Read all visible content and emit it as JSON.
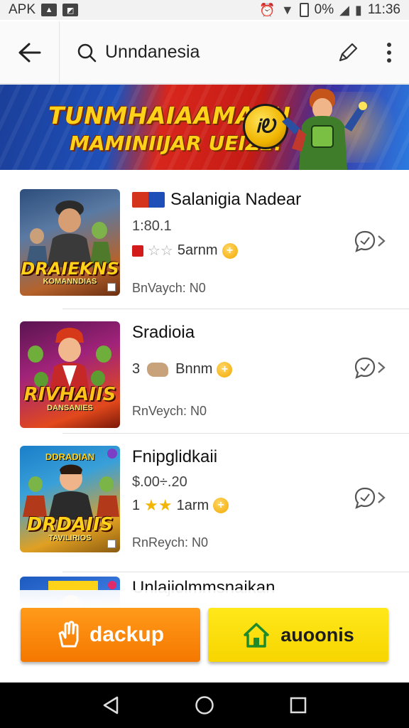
{
  "status_bar": {
    "left_label": "APK",
    "battery_text": "0%",
    "time": "11:36"
  },
  "app_bar": {
    "search_text": "Unndanesia"
  },
  "banner": {
    "line1": "TUNMHAIAAMAEH",
    "line2": "MAMINIIJAR UEIZE!",
    "badge_text": "ᎥᎧ"
  },
  "items": [
    {
      "title": "Salanigia Nadear",
      "price": "1:80.1",
      "rating_label": "5arnm",
      "subtitle": "BnVaych: N0",
      "thumb_title": "DRAIEKNS",
      "thumb_sub": "KOMANNDIAS",
      "thumb_colors": [
        "#3b6ea8",
        "#c95e1c"
      ]
    },
    {
      "title": "Sradioia",
      "price": "",
      "rating_prefix": "3",
      "rating_label": "Bnnm",
      "subtitle": "RnVeych: N0",
      "thumb_title": "RIVHAIIS",
      "thumb_sub": "DANSANIES",
      "thumb_colors": [
        "#7a1c5c",
        "#e0341e"
      ]
    },
    {
      "title": "Fnipglidkaii",
      "price": "$.00÷.20",
      "rating_prefix": "1",
      "rating_label": "1arm",
      "subtitle": "RnReych: N0",
      "thumb_title": "DRDAIIS",
      "thumb_sub": "TAVILIRIOS",
      "thumb_header": "DDRADIAN",
      "thumb_colors": [
        "#1d8ad0",
        "#e8a21a"
      ]
    },
    {
      "title": "Unlajiolmmsnaikan",
      "thumb_colors": [
        "#1d5ac0",
        "#d12a1a"
      ]
    }
  ],
  "buttons": {
    "left_label": "dackup",
    "right_label": "auoonis"
  },
  "colors": {
    "accent_orange": "#f57800",
    "accent_yellow": "#f7d500",
    "banner_red": "#c41b14",
    "banner_blue": "#1e4fb8"
  },
  "icons": [
    "back-arrow-icon",
    "search-icon",
    "edit-pen-icon",
    "more-vert-icon",
    "chat-bubble-icon",
    "chevron-right-icon",
    "hand-icon",
    "home-icon",
    "nav-back-icon",
    "nav-home-icon",
    "nav-recents-icon"
  ]
}
